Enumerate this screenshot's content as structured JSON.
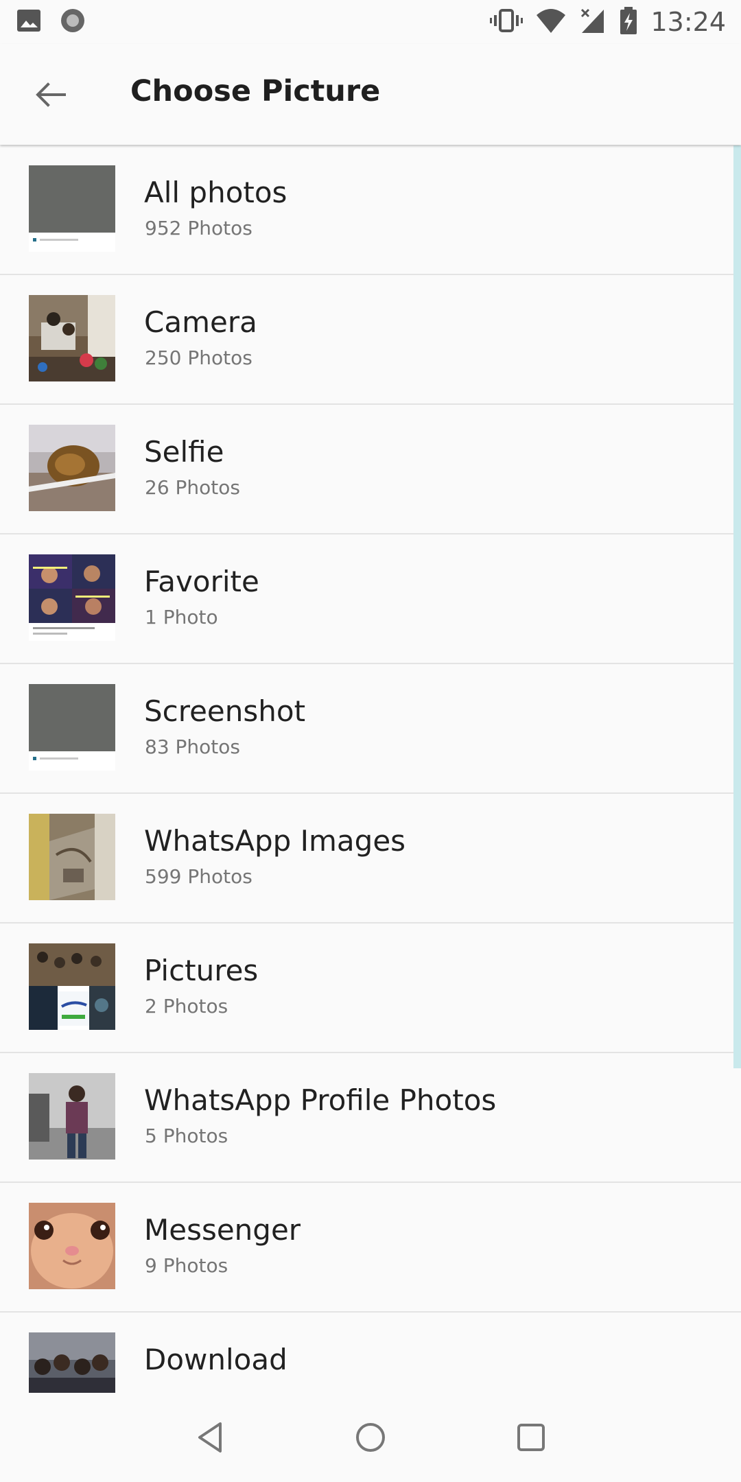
{
  "status_bar": {
    "time": "13:24"
  },
  "app_bar": {
    "title": "Choose Picture"
  },
  "albums": [
    {
      "name": "All photos",
      "count": "952 Photos"
    },
    {
      "name": "Camera",
      "count": "250 Photos"
    },
    {
      "name": "Selfie",
      "count": "26 Photos"
    },
    {
      "name": "Favorite",
      "count": "1 Photo"
    },
    {
      "name": "Screenshot",
      "count": "83 Photos"
    },
    {
      "name": "WhatsApp Images",
      "count": "599 Photos"
    },
    {
      "name": "Pictures",
      "count": "2 Photos"
    },
    {
      "name": "WhatsApp Profile Photos",
      "count": "5 Photos"
    },
    {
      "name": "Messenger",
      "count": "9 Photos"
    },
    {
      "name": "Download",
      "count": ""
    }
  ],
  "colors": {
    "background": "#fafafa",
    "divider": "#e3e3e3",
    "scroll_indicator": "#c9e9ec",
    "title_text": "#1f1f1f",
    "secondary_text": "#757575"
  },
  "icons": {
    "status_left": [
      "image-icon",
      "circle-notification-icon"
    ],
    "status_right": [
      "vibrate-icon",
      "wifi-icon",
      "signal-icon",
      "battery-charging-icon"
    ],
    "nav": [
      "back-triangle-icon",
      "home-circle-icon",
      "recents-square-icon"
    ]
  }
}
